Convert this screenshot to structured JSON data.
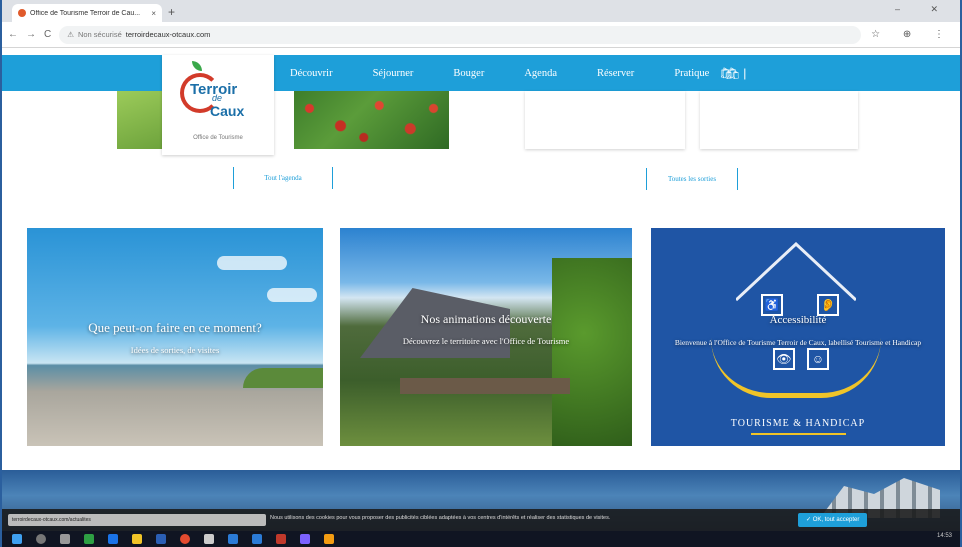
{
  "browser": {
    "tab_title": "Office de Tourisme Terroir de Cau...",
    "tab_close": "×",
    "new_tab": "+",
    "window_controls": "– ✕",
    "nav_back": "←",
    "nav_forward": "→",
    "nav_reload": "C",
    "lock": "⚠",
    "not_secure": "Non sécurisé",
    "url": "terroirdecaux-otcaux.com",
    "toolbar_right": "☆ ⊕ ⋮"
  },
  "site": {
    "logo": {
      "line1": "Terroir",
      "line2": "de",
      "line3": "Caux",
      "subtitle": "Office de Tourisme"
    },
    "menu": [
      "Découvrir",
      "Séjourner",
      "Bouger",
      "Agenda",
      "Réserver",
      "Pratique"
    ],
    "menu_sep": "|",
    "cart_icon": "🛍",
    "link_all_events": "Tout l'agenda",
    "link_all_offers": "Toutes les sorties",
    "features": [
      {
        "title": "Que peut-on faire en ce moment?",
        "subtitle": "Idées de sorties, de visites"
      },
      {
        "title": "Nos animations découverte",
        "subtitle": "Découvrez le territoire avec l'Office de Tourisme"
      },
      {
        "title": "Accessibilité",
        "subtitle": "Bienvenue à l'Office de Tourisme Terroir de Caux, labellisé Tourisme et Handicap",
        "brand": "TOURISME & HANDICAP"
      }
    ],
    "cookie": {
      "chip": "terroirdecaux-otcaux.com/actualites",
      "text": "Nous utilisons des cookies pour vous proposer des publicités ciblées adaptées à vos centres d'intérêts et réaliser des statistiques de visites.",
      "accept": "✓ OK, tout accepter"
    }
  },
  "taskbar": {
    "tray": "14:53"
  },
  "colors": {
    "brand_blue": "#1e9fd9",
    "handicap_blue": "#1f55a5",
    "apple_red": "#d23b2a"
  }
}
